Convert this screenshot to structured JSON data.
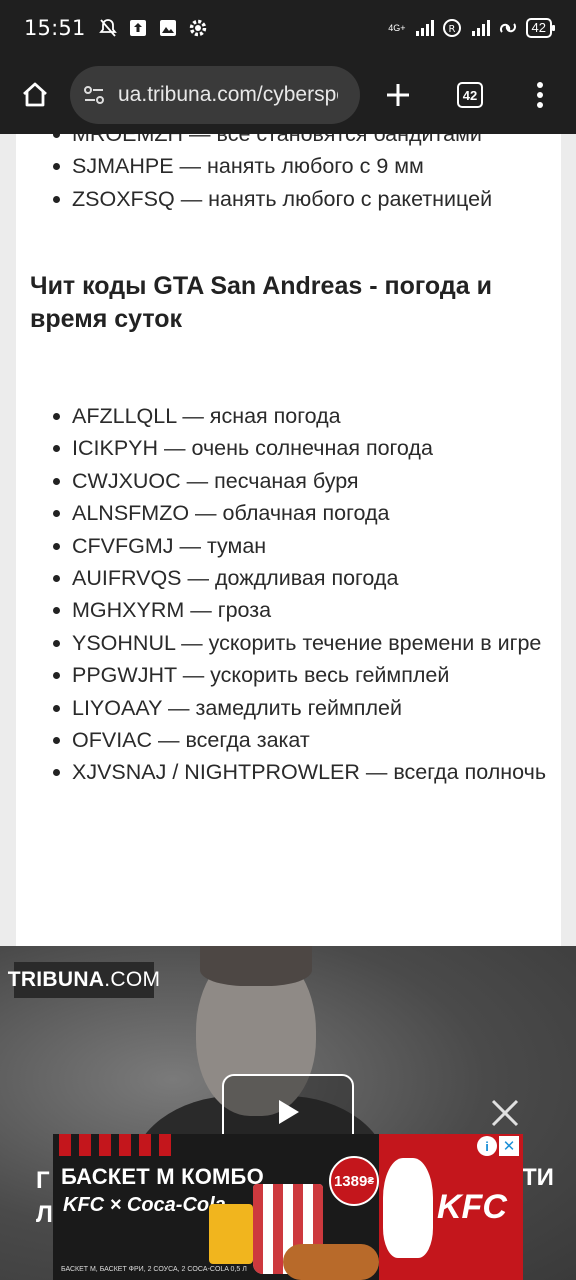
{
  "status_bar": {
    "time": "15:51",
    "network": "4G+",
    "battery": "42",
    "left_icons": [
      "mute-bell-icon",
      "upload-icon",
      "photo-icon",
      "gear-icon"
    ],
    "right_icons": [
      "signal-icon",
      "registered-icon",
      "signal-icon",
      "link-icon",
      "battery-icon"
    ]
  },
  "browser": {
    "url": "ua.tribuna.com/cybersport",
    "tab_count": "42"
  },
  "article": {
    "top_items": [
      "MROEMZH — все становятся бандитами",
      "SJMAHPE — нанять любого с 9 мм",
      "ZSOXFSQ — нанять любого с ракетницей"
    ],
    "heading": "Чит коды GTA San Andreas - погода и время суток",
    "weather_items": [
      "AFZLLQLL — ясная погода",
      "ICIKPYH — очень солнечная погода",
      "CWJXUOC — песчаная буря",
      "ALNSFMZO — облачная погода",
      "CFVFGMJ — туман",
      "AUIFRVQS — дождливая погода",
      "MGHXYRM — гроза",
      "YSOHNUL — ускорить течение времени в игре",
      "PPGWJHT — ускорить весь геймплей",
      "LIYOAAY — замедлить геймплей",
      "OFVIAC — всегда закат",
      "XJVSNAJ / NIGHTPROWLER — всегда полночь"
    ]
  },
  "video": {
    "logo_bold": "TRIBUNA",
    "logo_light": ".COM",
    "title_left": "Г\nЛ",
    "title_right": "ТИ"
  },
  "ad": {
    "title": "БАСКЕТ М КОМБО",
    "brands": "KFC × Coca-Cola",
    "price": "1389",
    "price_currency": "₴",
    "brand": "KFC",
    "fine_print": "БАСКЕТ М, БАСКЕТ ФРИ, 2 СОУСА, 2 COCA-COLA 0,5 Л",
    "info_label": "i",
    "close_label": "✕"
  }
}
